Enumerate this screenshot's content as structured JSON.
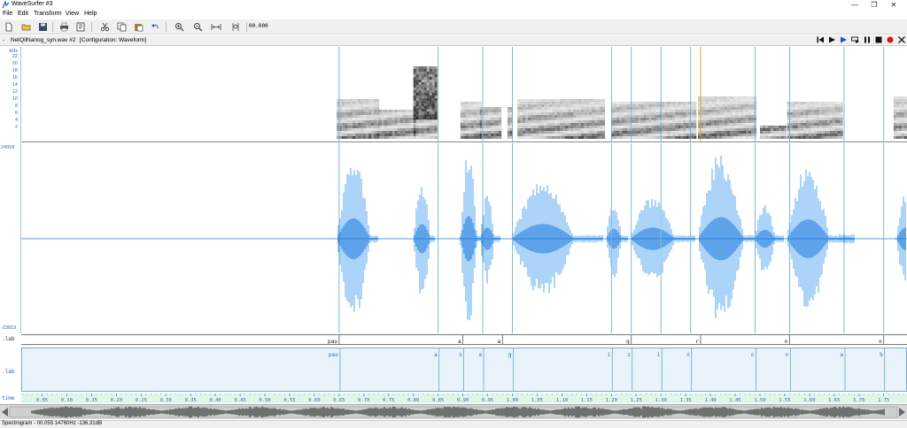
{
  "window": {
    "title": "WaveSurfer #3",
    "minimize_glyph": "—",
    "maximize_glyph": "❐",
    "close_glyph": "✕"
  },
  "menu": [
    "File",
    "Edit",
    "Transform",
    "View",
    "Help"
  ],
  "toolbar": {
    "icons": [
      "new-file-icon",
      "open-folder-icon",
      "save-icon",
      "print-icon",
      "properties-icon",
      "cut-icon",
      "copy-icon",
      "paste-icon",
      "undo-icon",
      "zoom-in-icon",
      "zoom-out-icon",
      "zoom-fit-icon",
      "zoom-selection-icon"
    ],
    "time": "00.000"
  },
  "sound": {
    "collapse_glyph": "-",
    "file": "NetQilNanog_syn.wav #2",
    "config": "[Configuration: Waveform]"
  },
  "playback": {
    "icons": [
      "skip-start-icon",
      "play-icon",
      "play-selection-icon",
      "loop-icon",
      "pause-icon",
      "stop-icon",
      "record-icon",
      "close-icon"
    ]
  },
  "spectrogram": {
    "unit": "kHz",
    "ticks": [
      "22",
      "20",
      "18",
      "16",
      "14",
      "12",
      "10",
      "8",
      "6",
      "4",
      "2"
    ]
  },
  "waveform": {
    "max_label": "24918",
    "min_label": "-23819",
    "color": "#1a7be0",
    "light_color": "#5aa8f0"
  },
  "label_tier1": {
    "name": ".lab",
    "labels": [
      {
        "t": 0.65,
        "text": "pau"
      },
      {
        "t": 0.9,
        "text": "a"
      },
      {
        "t": 0.98,
        "text": "a"
      },
      {
        "t": 1.24,
        "text": "g"
      },
      {
        "t": 1.38,
        "text": "r"
      },
      {
        "t": 1.56,
        "text": "n"
      },
      {
        "t": 1.75,
        "text": "n"
      }
    ]
  },
  "label_tier2": {
    "name": ".lab",
    "labels": [
      {
        "t": 0.65,
        "text": "pau"
      },
      {
        "t": 0.85,
        "text": "a"
      },
      {
        "t": 0.9,
        "text": "s"
      },
      {
        "t": 0.94,
        "text": "a"
      },
      {
        "t": 1.0,
        "text": "g"
      },
      {
        "t": 1.2,
        "text": "i"
      },
      {
        "t": 1.24,
        "text": "z"
      },
      {
        "t": 1.3,
        "text": "i"
      },
      {
        "t": 1.36,
        "text": "n"
      },
      {
        "t": 1.49,
        "text": "o"
      },
      {
        "t": 1.56,
        "text": "n"
      },
      {
        "t": 1.67,
        "text": "a"
      },
      {
        "t": 1.75,
        "text": "b"
      }
    ]
  },
  "time_axis": {
    "name": "time",
    "ticks": [
      "0.05",
      "0.10",
      "0.15",
      "0.20",
      "0.25",
      "0.30",
      "0.35",
      "0.40",
      "0.45",
      "0.50",
      "0.55",
      "0.60",
      "0.65",
      "0.70",
      "0.75",
      "0.80",
      "0.85",
      "0.90",
      "0.95",
      "1.00",
      "1.05",
      "1.10",
      "1.15",
      "1.20",
      "1.25",
      "1.30",
      "1.35",
      "1.40",
      "1.45",
      "1.50",
      "1.55",
      "1.60",
      "1.65",
      "1.70",
      "1.75"
    ]
  },
  "boundaries": [
    0.65,
    0.85,
    0.94,
    1.0,
    1.2,
    1.24,
    1.3,
    1.36,
    1.49,
    1.56,
    1.67,
    1.75
  ],
  "cursor_time": 1.38,
  "status": "Spectrogram - 00.055 14760Hz -136.31dB"
}
